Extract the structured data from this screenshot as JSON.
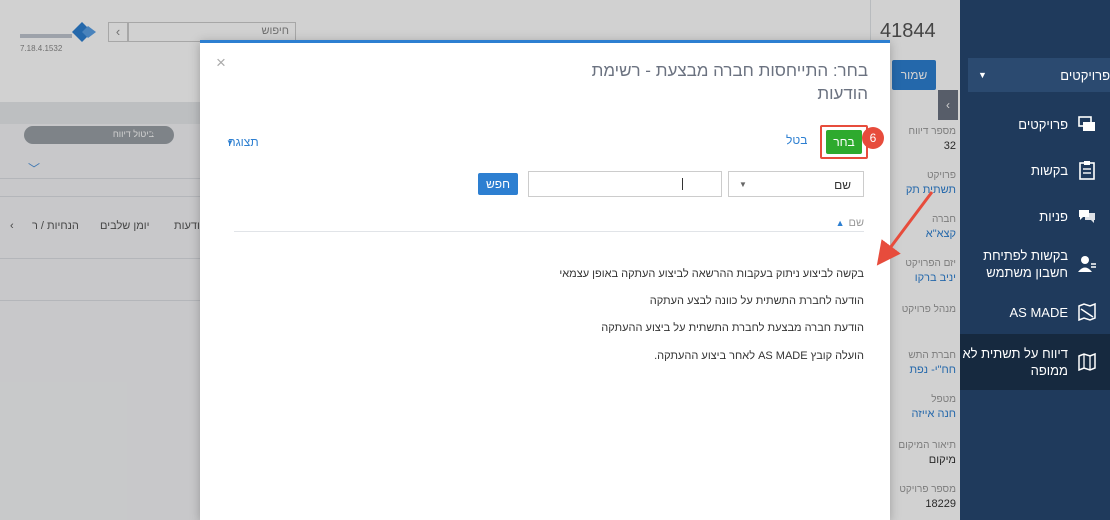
{
  "app": {
    "version": "7.18.4.1532",
    "record_id": "41844",
    "search_placeholder": "חיפוש",
    "save_label": "שמור"
  },
  "sidebar": {
    "dropdown_label": "פרויקטים",
    "items": [
      {
        "label": "פרויקטים",
        "icon": "projects-icon"
      },
      {
        "label": "בקשות",
        "icon": "clipboard-icon"
      },
      {
        "label": "פניות",
        "icon": "chat-icon"
      },
      {
        "label": "בקשות לפתיחת חשבון משתמש",
        "icon": "user-add-icon"
      },
      {
        "label": "AS MADE",
        "icon": "map-icon"
      },
      {
        "label": "דיווח על תשתית לא ממופה",
        "icon": "map-report-icon"
      }
    ],
    "active_index": 5
  },
  "background": {
    "pill_label": "ביטול דיווח",
    "tabs": [
      "הנחיות / ר",
      "יומן שלבים",
      "הודעות"
    ],
    "record_fields": [
      {
        "label": "מספר דיווח",
        "value": "32",
        "link": false
      },
      {
        "label": "פרויקט",
        "value": "תשתית תק",
        "link": true
      },
      {
        "label": "חברה",
        "value": "קצא\"א",
        "link": true
      },
      {
        "label": "יזם הפרויקט",
        "value": "יניב ברקו",
        "link": true
      },
      {
        "label": "מנהל פרויקט",
        "value": "",
        "link": false
      },
      {
        "label": "חברת התש",
        "value": "חח\"י- נפת",
        "link": true
      },
      {
        "label": "מטפל",
        "value": "חנה אייזה",
        "link": true
      },
      {
        "label": "תיאור המיקום",
        "value": "מיקום",
        "link": false
      },
      {
        "label": "מספר פרויקט",
        "value": "18229",
        "link": false
      }
    ]
  },
  "modal": {
    "title": "בחר: התייחסות חברה מבצעת - רשימת הודעות",
    "choose_label": "בחר",
    "cancel_label": "בטל",
    "view_label": "תצוגה",
    "step_badge": "6",
    "filter_field": "שם",
    "search_value": "",
    "search_button": "חפש",
    "column_header": "שם",
    "rows": [
      "בקשה לביצוע ניתוק בעקבות ההרשאה לביצוע העתקה באופן עצמאי",
      "הודעה לחברת התשתית על כוונה לבצע העתקה",
      "הודעת חברה מבצעת לחברת התשתית על ביצוע ההעתקה",
      "הועלה קובץ AS MADE לאחר ביצוע ההעתקה."
    ]
  },
  "colors": {
    "sidebar_bg": "#1f3a5c",
    "primary": "#2d7fd1",
    "choose_green": "#2eaa2e",
    "annotation_red": "#e74c3c"
  }
}
